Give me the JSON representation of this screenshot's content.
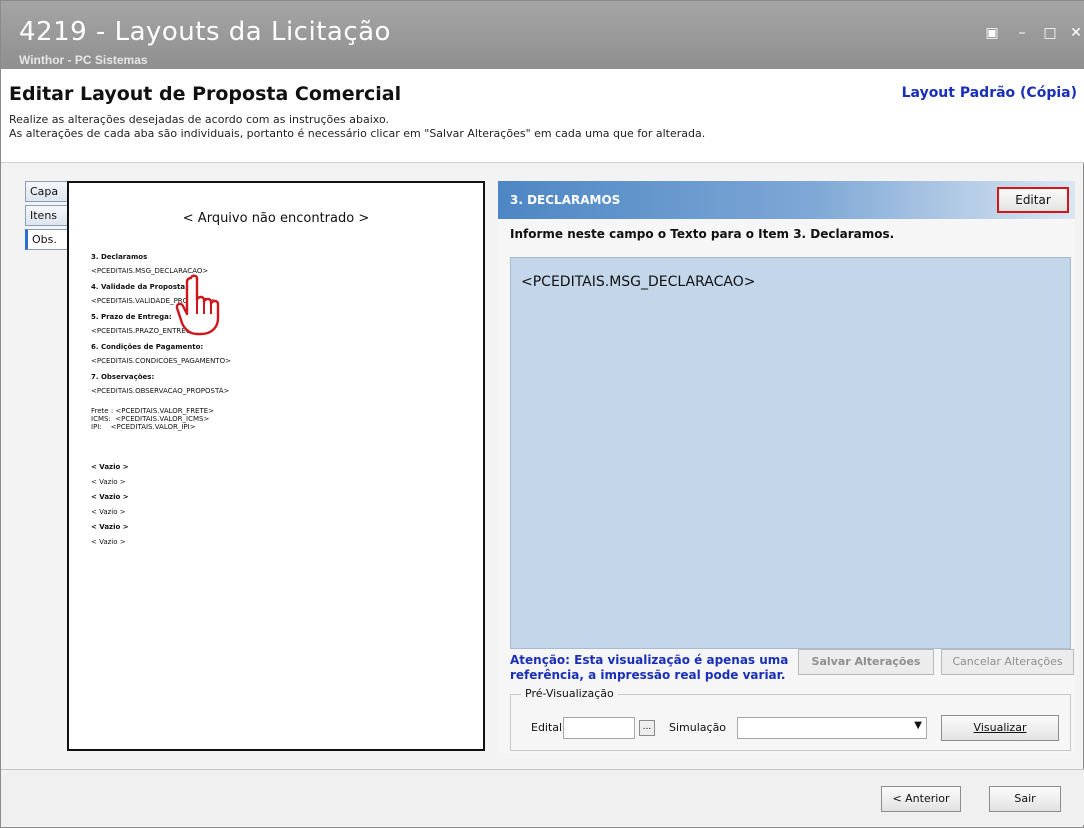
{
  "window": {
    "title": "4219 - Layouts da Licitação",
    "subtitle": "Winthor - PC Sistemas",
    "controls": {
      "restore": "▣",
      "minimize": "–",
      "maximize": "□",
      "close": "✕"
    }
  },
  "header": {
    "title": "Editar Layout de Proposta Comercial",
    "layout_name": "Layout Padrão (Cópia)",
    "instruction_1": "Realize as alterações desejadas de acordo com as instruções abaixo.",
    "instruction_2": "As alterações de cada aba são individuais, portanto é necessário clicar em \"Salvar Alterações\" em cada uma que for alterada."
  },
  "tabs": [
    {
      "label": "Capa",
      "active": false
    },
    {
      "label": "Itens",
      "active": false
    },
    {
      "label": "Obs.",
      "active": true
    }
  ],
  "preview": {
    "not_found": "< Arquivo não encontrado >",
    "lines": [
      {
        "text": "3. Declaramos",
        "bold": true
      },
      {
        "text": "<PCEDITAIS.MSG_DECLARACAO>",
        "bold": false
      },
      {
        "text": "4. Validade da Proposta:",
        "bold": true
      },
      {
        "text": "<PCEDITAIS.VALIDADE_PROPOSTA>",
        "bold": false
      },
      {
        "text": "5. Prazo de Entrega:",
        "bold": true
      },
      {
        "text": "<PCEDITAIS.PRAZO_ENTREGA>",
        "bold": false
      },
      {
        "text": "6. Condições de Pagamento:",
        "bold": true
      },
      {
        "text": "<PCEDITAIS.CONDICOES_PAGAMENTO>",
        "bold": false
      },
      {
        "text": "7. Observações:",
        "bold": true
      },
      {
        "text": "<PCEDITAIS.OBSERVACAO_PROPOSTA>",
        "bold": false
      },
      {
        "text": "Frete : <PCEDITAIS.VALOR_FRETE>",
        "bold": false
      },
      {
        "text": "ICMS:  <PCEDITAIS.VALOR_ICMS>",
        "bold": false
      },
      {
        "text": "IPI:    <PCEDITAIS.VALOR_IPI>",
        "bold": false
      },
      {
        "text": "< Vazio >",
        "bold": true
      },
      {
        "text": "< Vazio >",
        "bold": false
      },
      {
        "text": "< Vazio >",
        "bold": true
      },
      {
        "text": "< Vazio >",
        "bold": false
      },
      {
        "text": "< Vazio >",
        "bold": true
      },
      {
        "text": "< Vazio >",
        "bold": false
      }
    ]
  },
  "section": {
    "title": "3. DECLARAMOS",
    "edit_label": "Editar",
    "prompt": "Informe neste campo o Texto para o Item 3. Declaramos.",
    "text_value": "<PCEDITAIS.MSG_DECLARACAO>",
    "attention": "Atenção: Esta visualização é apenas uma referência, a impressão real pode variar.",
    "save_label": "Salvar Alterações",
    "cancel_label": "Cancelar Alterações"
  },
  "preview_group": {
    "legend": "Pré-Visualização",
    "edital_label": "Edital",
    "edital_value": "",
    "ellipsis": "...",
    "simulacao_label": "Simulação",
    "simulacao_value": "",
    "visualizar_label": "Visualizar"
  },
  "footer": {
    "prev_label": "< Anterior",
    "exit_label": "Sair"
  }
}
